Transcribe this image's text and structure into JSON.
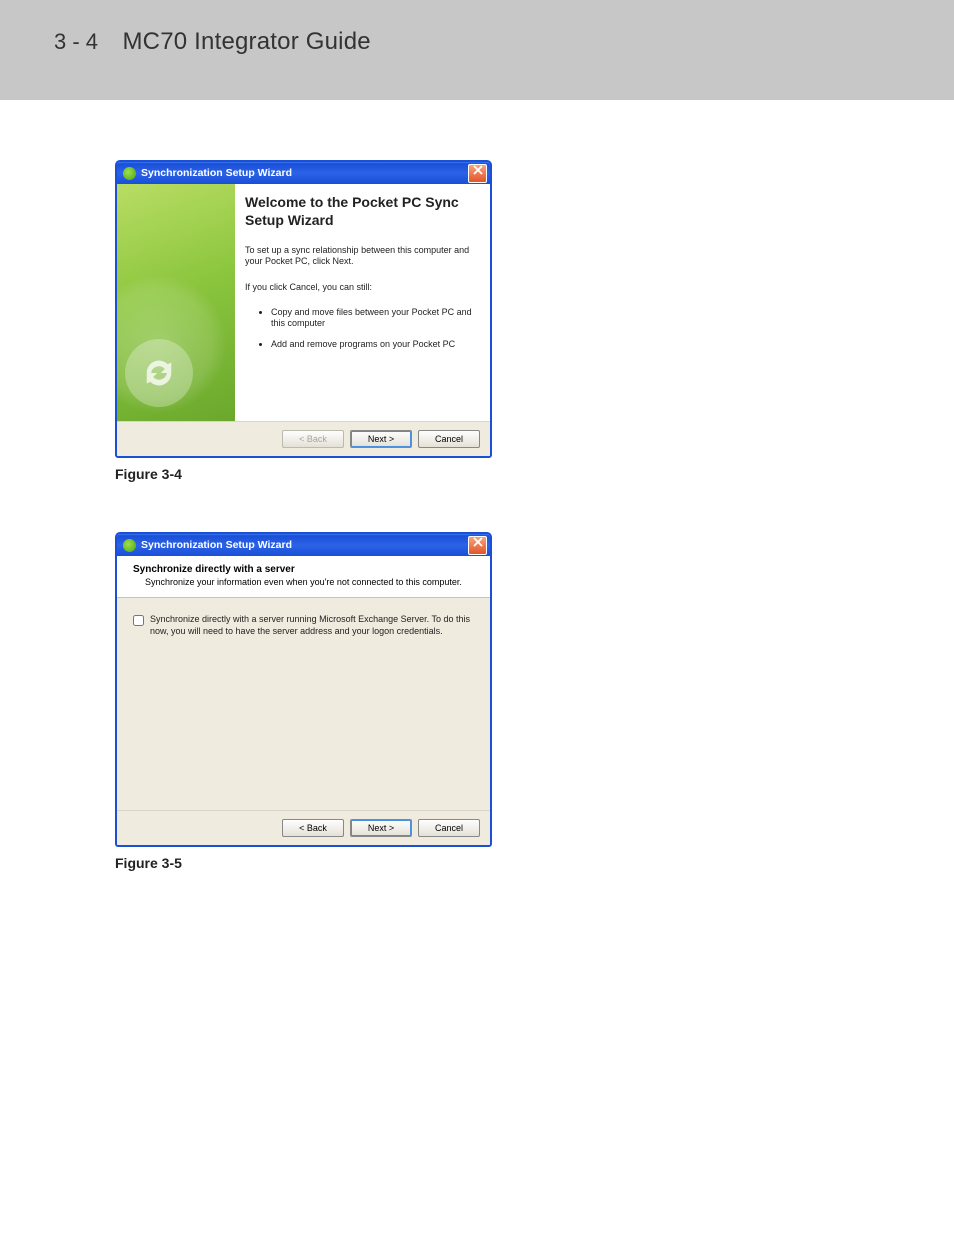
{
  "header": {
    "page_number": "3 - 4",
    "title": "MC70 Integrator Guide"
  },
  "dialog1": {
    "titlebar": "Synchronization Setup Wizard",
    "welcome_heading": "Welcome to the Pocket PC Sync Setup Wizard",
    "intro": "To set up a sync relationship between this computer and your Pocket PC, click Next.",
    "cancel_lead": "If you click Cancel, you can still:",
    "bullets": [
      "Copy and move files between your Pocket PC and this computer",
      "Add and remove programs on your Pocket PC"
    ],
    "buttons": {
      "back": "< Back",
      "next": "Next >",
      "cancel": "Cancel"
    }
  },
  "caption1": "Figure 3-4",
  "dialog2": {
    "titlebar": "Synchronization Setup Wizard",
    "heading": "Synchronize directly with a server",
    "subheading": "Synchronize your information even when you're not connected to this computer.",
    "checkbox_label": "Synchronize directly with a server running Microsoft Exchange Server.  To do this now, you will need to have the server address and your logon credentials.",
    "buttons": {
      "back": "< Back",
      "next": "Next >",
      "cancel": "Cancel"
    }
  },
  "caption2": "Figure 3-5"
}
